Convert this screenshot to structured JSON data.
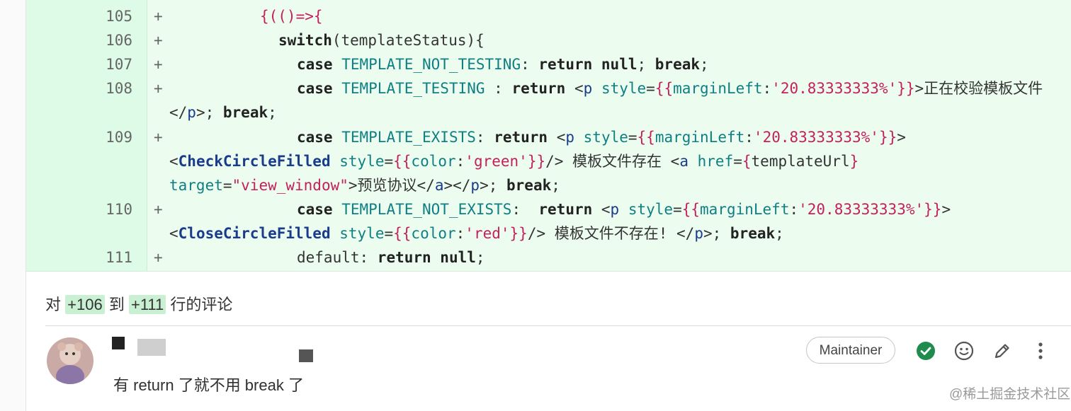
{
  "diff_lines": [
    {
      "num": "105",
      "sign": "+"
    },
    {
      "num": "106",
      "sign": "+"
    },
    {
      "num": "107",
      "sign": "+"
    },
    {
      "num": "108",
      "sign": "+"
    },
    {
      "num": "109",
      "sign": "+"
    },
    {
      "num": "110",
      "sign": "+"
    },
    {
      "num": "111",
      "sign": "+"
    }
  ],
  "comment": {
    "prefix": "对",
    "from_line": "+106",
    "middle": "到",
    "to_line": "+111",
    "suffix": "行的评论",
    "role_badge": "Maintainer",
    "body": "有 return 了就不用 break 了",
    "icons": [
      "resolve-check-icon",
      "emoji-icon",
      "edit-pencil-icon",
      "more-vertical-icon"
    ]
  },
  "watermark": "@稀土掘金技术社区",
  "colors": {
    "diff_bg": "#ecfdf0",
    "accent_green": "#1f8b4c",
    "keyword_teal": "#0f7f84",
    "string_red": "#c4205c"
  }
}
